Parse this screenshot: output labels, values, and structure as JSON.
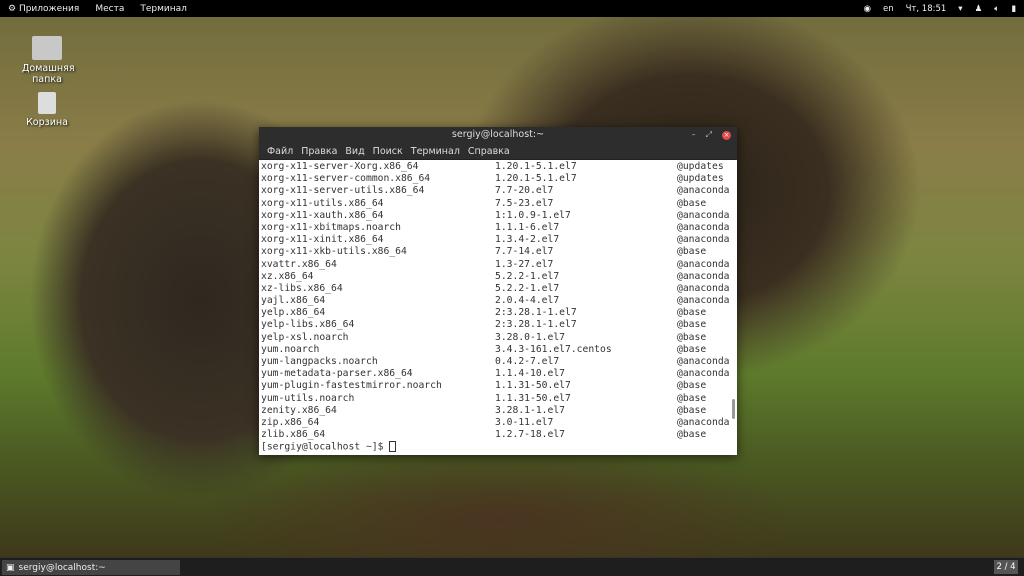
{
  "topbar": {
    "apps": "Приложения",
    "places": "Места",
    "terminal": "Терминал",
    "lang": "en",
    "clock": "Чт, 18:51"
  },
  "desktop": {
    "home": "Домашняя папка",
    "trash": "Корзина"
  },
  "window": {
    "title": "sergiy@localhost:~",
    "menu": [
      "Файл",
      "Правка",
      "Вид",
      "Поиск",
      "Терминал",
      "Справка"
    ],
    "rows": [
      [
        "xorg-x11-server-Xorg.x86_64",
        "1.20.1-5.1.el7",
        "@updates"
      ],
      [
        "xorg-x11-server-common.x86_64",
        "1.20.1-5.1.el7",
        "@updates"
      ],
      [
        "xorg-x11-server-utils.x86_64",
        "7.7-20.el7",
        "@anaconda"
      ],
      [
        "xorg-x11-utils.x86_64",
        "7.5-23.el7",
        "@base"
      ],
      [
        "xorg-x11-xauth.x86_64",
        "1:1.0.9-1.el7",
        "@anaconda"
      ],
      [
        "xorg-x11-xbitmaps.noarch",
        "1.1.1-6.el7",
        "@anaconda"
      ],
      [
        "xorg-x11-xinit.x86_64",
        "1.3.4-2.el7",
        "@anaconda"
      ],
      [
        "xorg-x11-xkb-utils.x86_64",
        "7.7-14.el7",
        "@base"
      ],
      [
        "xvattr.x86_64",
        "1.3-27.el7",
        "@anaconda"
      ],
      [
        "xz.x86_64",
        "5.2.2-1.el7",
        "@anaconda"
      ],
      [
        "xz-libs.x86_64",
        "5.2.2-1.el7",
        "@anaconda"
      ],
      [
        "yajl.x86_64",
        "2.0.4-4.el7",
        "@anaconda"
      ],
      [
        "yelp.x86_64",
        "2:3.28.1-1.el7",
        "@base"
      ],
      [
        "yelp-libs.x86_64",
        "2:3.28.1-1.el7",
        "@base"
      ],
      [
        "yelp-xsl.noarch",
        "3.28.0-1.el7",
        "@base"
      ],
      [
        "yum.noarch",
        "3.4.3-161.el7.centos",
        "@base"
      ],
      [
        "yum-langpacks.noarch",
        "0.4.2-7.el7",
        "@anaconda"
      ],
      [
        "yum-metadata-parser.x86_64",
        "1.1.4-10.el7",
        "@anaconda"
      ],
      [
        "yum-plugin-fastestmirror.noarch",
        "1.1.31-50.el7",
        "@base"
      ],
      [
        "yum-utils.noarch",
        "1.1.31-50.el7",
        "@base"
      ],
      [
        "zenity.x86_64",
        "3.28.1-1.el7",
        "@base"
      ],
      [
        "zip.x86_64",
        "3.0-11.el7",
        "@anaconda"
      ],
      [
        "zlib.x86_64",
        "1.2.7-18.el7",
        "@base"
      ]
    ],
    "prompt": "[sergiy@localhost ~]$ "
  },
  "taskbar": {
    "task": "sergiy@localhost:~",
    "workspace": "2 / 4"
  }
}
